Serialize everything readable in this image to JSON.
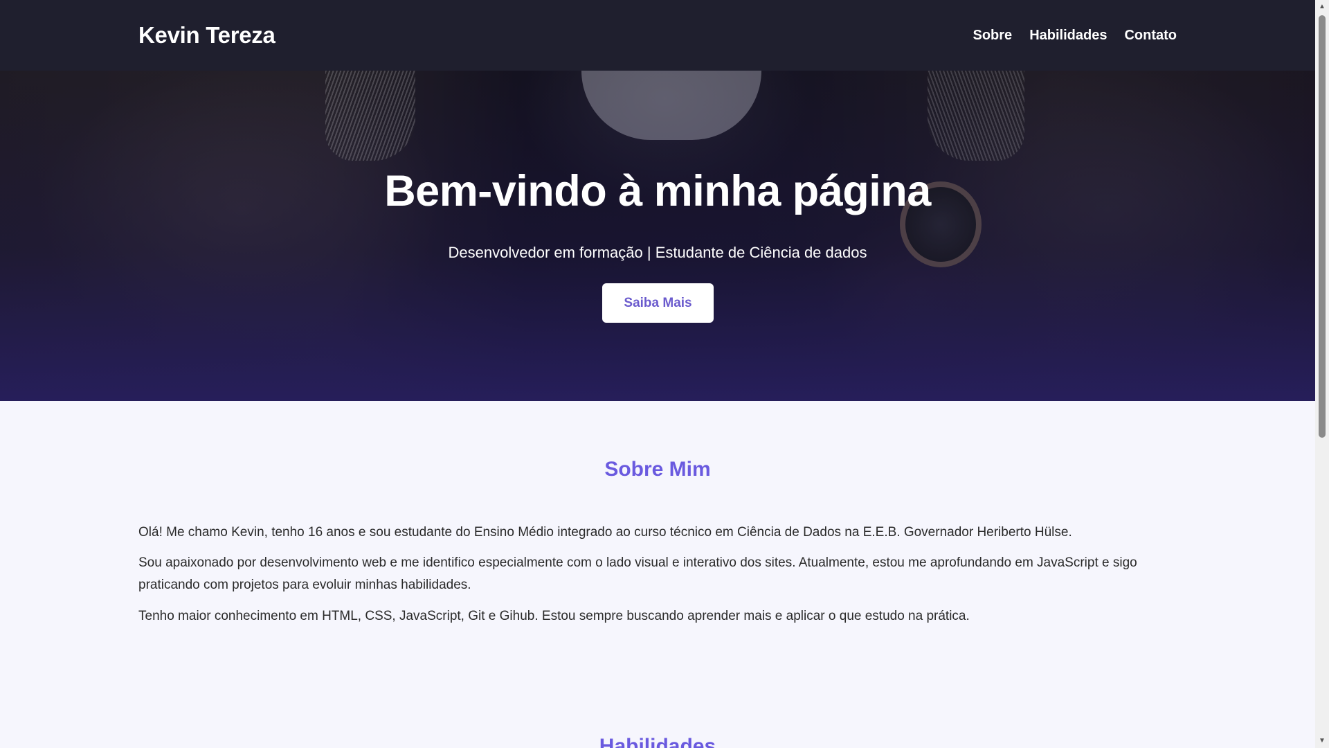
{
  "header": {
    "brand": "Kevin Tereza",
    "nav": [
      {
        "label": "Sobre"
      },
      {
        "label": "Habilidades"
      },
      {
        "label": "Contato"
      }
    ]
  },
  "hero": {
    "title": "Bem-vindo à minha página",
    "subtitle": "Desenvolvedor em formação | Estudante de Ciência de dados",
    "cta_label": "Saiba Mais"
  },
  "about": {
    "title": "Sobre Mim",
    "paragraphs": [
      "Olá! Me chamo Kevin, tenho 16 anos e sou estudante do Ensino Médio integrado ao curso técnico em Ciência de Dados na E.E.B. Governador Heriberto Hülse.",
      "Sou apaixonado por desenvolvimento web e me identifico especialmente com o lado visual e interativo dos sites. Atualmente, estou me aprofundando em JavaScript e sigo praticando com projetos para evoluir minhas habilidades.",
      "Tenho maior conhecimento em HTML, CSS, JavaScript, Git e Gihub. Estou sempre buscando aprender mais e aplicar o que estudo na prática."
    ]
  },
  "skills": {
    "title": "Habilidades"
  },
  "colors": {
    "navbar": "#1f1f2e",
    "accent": "#6a5adf",
    "hero_bottom": "#261e5a",
    "page_bg": "#f6f6fd"
  },
  "icons": {
    "scroll_up": "triangle-up-icon",
    "scroll_down": "triangle-down-icon"
  }
}
